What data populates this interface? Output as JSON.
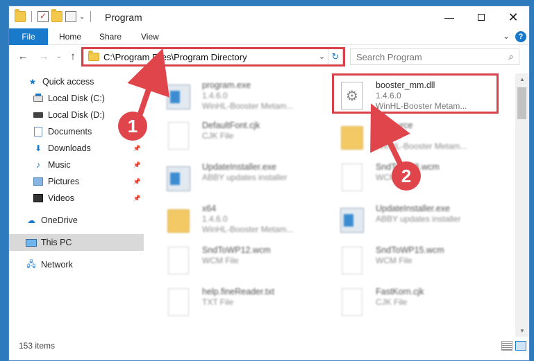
{
  "window": {
    "title": "Program",
    "minimize_label": "—",
    "close_label": "✕"
  },
  "ribbon": {
    "file": "File",
    "home": "Home",
    "share": "Share",
    "view": "View",
    "expand": "⌄",
    "help": "?"
  },
  "nav": {
    "back": "←",
    "forward": "→",
    "recent": "⌄",
    "up": "↑",
    "address": "C:\\Program Files\\Program Directory",
    "address_dropdown": "⌄",
    "refresh": "↻",
    "search_placeholder": "Search Program",
    "search_icon": "⌕"
  },
  "sidebar": {
    "items": [
      {
        "label": "Quick access",
        "icon": "star-icon"
      },
      {
        "label": "Local Disk (C:)",
        "icon": "disk-icon"
      },
      {
        "label": "Local Disk (D:)",
        "icon": "disk-icon"
      },
      {
        "label": "Documents",
        "icon": "documents-icon"
      },
      {
        "label": "Downloads",
        "icon": "downloads-icon",
        "pinned": true
      },
      {
        "label": "Music",
        "icon": "music-icon",
        "pinned": true
      },
      {
        "label": "Pictures",
        "icon": "pictures-icon",
        "pinned": true
      },
      {
        "label": "Videos",
        "icon": "videos-icon",
        "pinned": true
      },
      {
        "label": "OneDrive",
        "icon": "cloud-icon"
      },
      {
        "label": "This PC",
        "icon": "pc-icon",
        "selected": true
      },
      {
        "label": "Network",
        "icon": "network-icon"
      }
    ],
    "pin_glyph": "📌"
  },
  "files": [
    {
      "name": "program.exe",
      "meta1": "1.4.6.0",
      "meta2": "WinHL-Booster Metam...",
      "icon": "exe-icon"
    },
    {
      "name": "booster_mm.dll",
      "meta1": "1.4.6.0",
      "meta2": "WinHL-Booster Metam...",
      "icon": "gears-icon"
    },
    {
      "name": "DefaultFont.cjk",
      "meta1": "CJK File",
      "meta2": "",
      "icon": "page-icon"
    },
    {
      "name": "Resource",
      "meta1": "1.4.6.0",
      "meta2": "WinHL-Booster Metam...",
      "icon": "folder-icon"
    },
    {
      "name": "UpdateInstaller.exe",
      "meta1": "ABBY updates installer",
      "meta2": "",
      "icon": "exe-icon"
    },
    {
      "name": "SndToWP8.wcm",
      "meta1": "WCM File",
      "meta2": "",
      "icon": "page-icon"
    },
    {
      "name": "x64",
      "meta1": "1.4.6.0",
      "meta2": "WinHL-Booster Metam...",
      "icon": "folder-icon"
    },
    {
      "name": "UpdateInstaller.exe",
      "meta1": "ABBY updates installer",
      "meta2": "",
      "icon": "exe-icon"
    },
    {
      "name": "SndToWP12.wcm",
      "meta1": "WCM File",
      "meta2": "",
      "icon": "page-icon"
    },
    {
      "name": "SndToWP15.wcm",
      "meta1": "WCM File",
      "meta2": "",
      "icon": "page-icon"
    },
    {
      "name": "help.fineReader.txt",
      "meta1": "TXT File",
      "meta2": "",
      "icon": "page-icon"
    },
    {
      "name": "FastKorn.cjk",
      "meta1": "CJK File",
      "meta2": "",
      "icon": "page-icon"
    }
  ],
  "status": {
    "item_count": "153 items"
  },
  "annotations": {
    "callout1": "1",
    "callout2": "2",
    "highlight_color": "#d9414a"
  },
  "colors": {
    "accent": "#1979ca",
    "desktop": "#2d7bbd"
  }
}
